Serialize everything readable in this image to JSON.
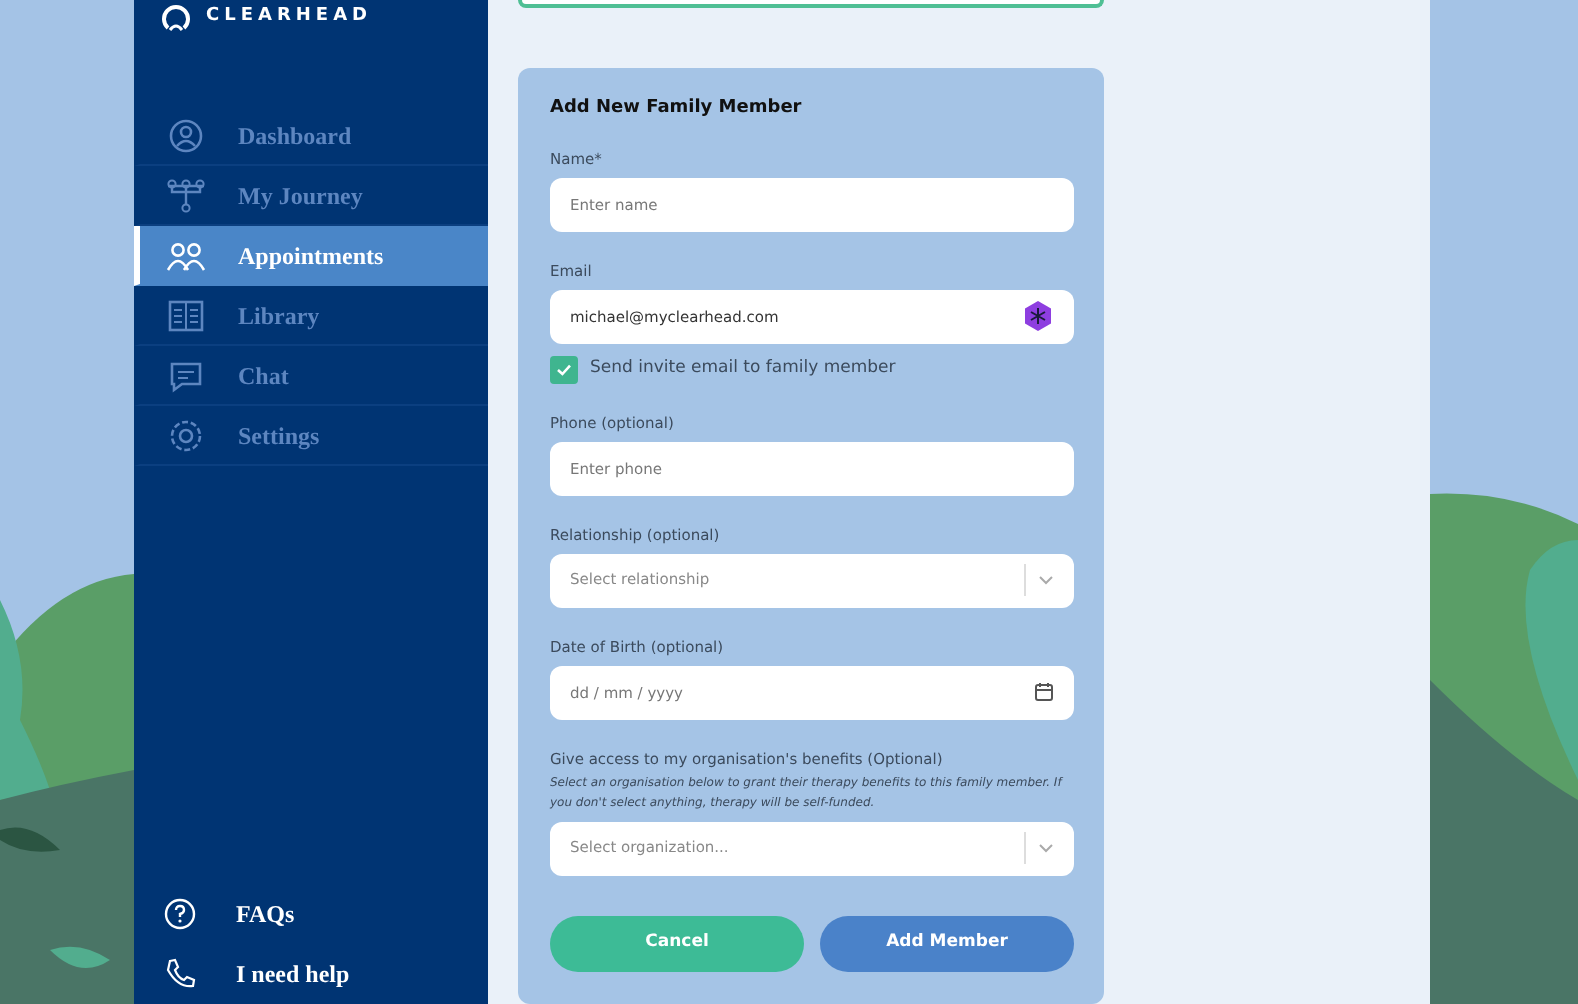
{
  "sidebar": {
    "logo": "CLEARHEAD",
    "items": [
      {
        "label": "Dashboard",
        "selected": false
      },
      {
        "label": "My Journey",
        "selected": false
      },
      {
        "label": "Appointments",
        "selected": true
      },
      {
        "label": "Library",
        "selected": false
      },
      {
        "label": "Chat",
        "selected": false
      },
      {
        "label": "Settings",
        "selected": false
      }
    ],
    "footer_items": [
      {
        "label": "FAQs"
      },
      {
        "label": "I need help"
      }
    ]
  },
  "form": {
    "title": "Add New Family Member",
    "fields": [
      {
        "kind": "text",
        "label": "Name*",
        "placeholder": "Enter name"
      },
      {
        "kind": "email",
        "label": "Email",
        "value": "michael@myclearhead.com"
      },
      {
        "kind": "checkbox",
        "label": "Send invite email to family member",
        "checked": true
      },
      {
        "kind": "text",
        "label": "Phone (optional)",
        "placeholder": "Enter phone"
      },
      {
        "kind": "select",
        "label": "Relationship (optional)",
        "placeholder": "Select relationship"
      },
      {
        "kind": "date",
        "label": "Date of Birth (optional)",
        "placeholder": "dd / mm / yyyy"
      },
      {
        "kind": "select",
        "label": "Give access to my organisation's benefits (Optional)",
        "help": "Select an organisation below to grant their therapy benefits to this family member. If you don't select anything, therapy will be self-funded.",
        "placeholder": "Select organization..."
      }
    ],
    "buttons": [
      {
        "label": "Cancel",
        "kind": "secondary"
      },
      {
        "label": "Add Member",
        "kind": "primary"
      }
    ]
  }
}
